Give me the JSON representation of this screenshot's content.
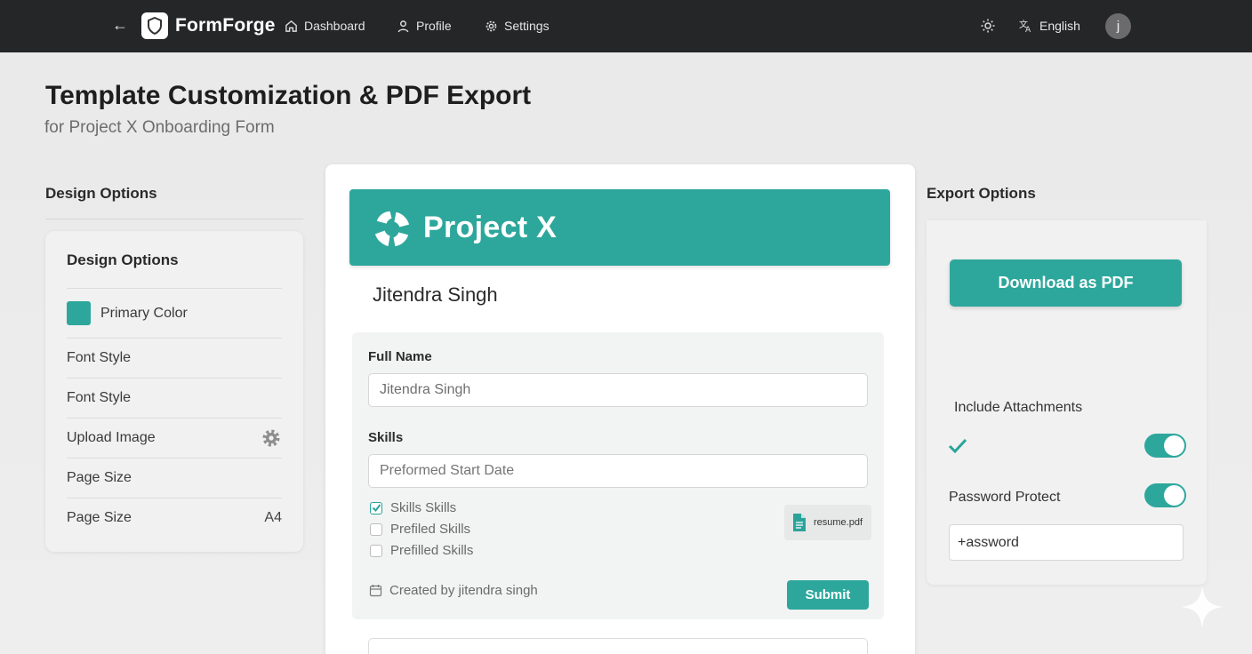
{
  "topbar": {
    "brand": "FormForge",
    "nav": [
      {
        "label": "Dashboard",
        "icon": "home-icon"
      },
      {
        "label": "Profile",
        "icon": "user-icon"
      },
      {
        "label": "Settings",
        "icon": "gear-icon"
      }
    ],
    "language": "English",
    "avatar_initial": "j"
  },
  "page": {
    "title": "Template Customization & PDF Export",
    "subtitle": "for Project X Onboarding Form"
  },
  "design_panel": {
    "heading": "Design Options",
    "card_title": "Design Options",
    "options": [
      {
        "label": "Primary Color",
        "value": ""
      },
      {
        "label": "Font Style",
        "value": ""
      },
      {
        "label": "Font Style",
        "value": ""
      },
      {
        "label": "Upload Image",
        "value": ""
      },
      {
        "label": "Page Size",
        "value": ""
      },
      {
        "label": "Page Size",
        "value": "A4"
      }
    ]
  },
  "preview": {
    "banner_title": "Project X",
    "respondent_name": "Jitendra Singh",
    "fields": {
      "full_name_label": "Full Name",
      "full_name_value": "Jitendra Singh",
      "skills_label": "Skills",
      "skills_placeholder": "Preformed Start Date"
    },
    "checkboxes": [
      {
        "label": "Skills Skills",
        "checked": true
      },
      {
        "label": "Prefiled Skills",
        "checked": false
      },
      {
        "label": "Prefilled Skills",
        "checked": false
      }
    ],
    "attachment": "resume.pdf",
    "created_by": "Created by jitendra singh",
    "submit_label": "Submit"
  },
  "export_panel": {
    "heading": "Export Options",
    "download_label": "Download as PDF",
    "include_attachments_label": "Include Attachments",
    "include_attachments_on": true,
    "password_protect_label": "Password Protect",
    "password_protect_on": true,
    "password_value": "+assword"
  },
  "colors": {
    "primary": "#2da79c",
    "topbar": "#252628"
  }
}
